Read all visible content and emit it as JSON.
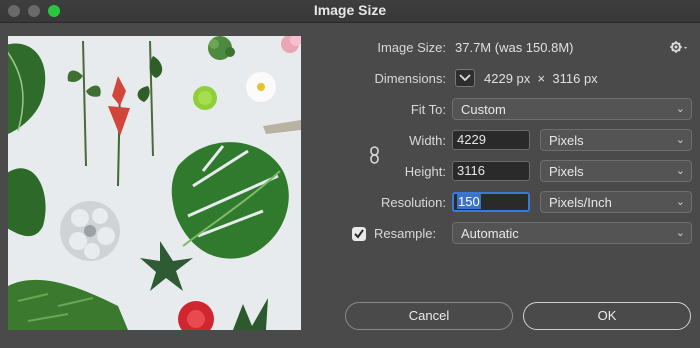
{
  "window": {
    "title": "Image Size"
  },
  "image_size": {
    "label": "Image Size:",
    "value": "37.7M (was 150.8M)"
  },
  "dimensions": {
    "label": "Dimensions:",
    "width": "4229",
    "unit_w": "px",
    "times": "×",
    "height": "3116",
    "unit_h": "px"
  },
  "fit_to": {
    "label": "Fit To:",
    "value": "Custom"
  },
  "width": {
    "label": "Width:",
    "value": "4229",
    "unit": "Pixels"
  },
  "height": {
    "label": "Height:",
    "value": "3116",
    "unit": "Pixels"
  },
  "resolution": {
    "label": "Resolution:",
    "value": "150",
    "unit": "Pixels/Inch"
  },
  "resample": {
    "label": "Resample:",
    "value": "Automatic",
    "checked": true
  },
  "buttons": {
    "cancel": "Cancel",
    "ok": "OK"
  },
  "icons": {
    "settings": "gear-icon",
    "link": "chain-link-icon",
    "dimensions_toggle": "chevron-down-icon"
  },
  "colors": {
    "accent": "#3b78d8",
    "window_bg": "#4a4a4a",
    "titlebar_green": "#2ac840"
  }
}
